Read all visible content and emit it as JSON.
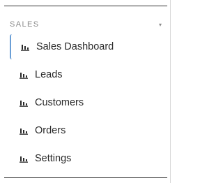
{
  "sidebar": {
    "section": {
      "title": "SALES",
      "caret": "▾"
    },
    "items": [
      {
        "label": "Sales Dashboard",
        "icon": "bar-chart-icon",
        "active": true
      },
      {
        "label": "Leads",
        "icon": "bar-chart-icon",
        "active": false
      },
      {
        "label": "Customers",
        "icon": "bar-chart-icon",
        "active": false
      },
      {
        "label": "Orders",
        "icon": "bar-chart-icon",
        "active": false
      },
      {
        "label": "Settings",
        "icon": "bar-chart-icon",
        "active": false
      }
    ]
  },
  "colors": {
    "active_indicator": "#6b9fd6",
    "section_title": "#8a8a8a",
    "divider": "#333333"
  }
}
